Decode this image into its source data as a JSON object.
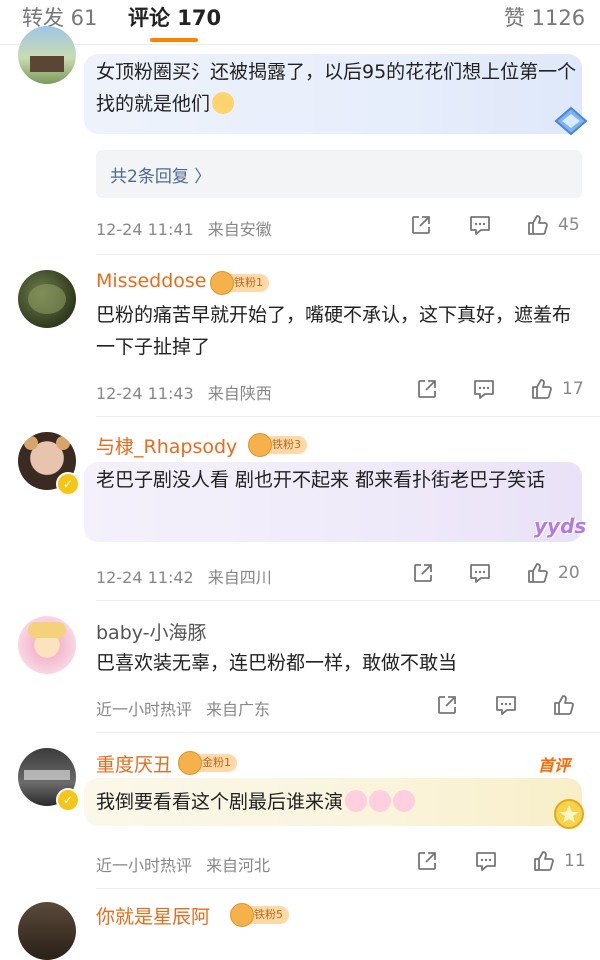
{
  "tabs": {
    "repost": "转发 61",
    "comments": "评论 170",
    "likes": "赞 1126"
  },
  "comments": [
    {
      "text": "女顶粉圈买氵还被揭露了，以后95的花花们想上位第一个找的就是他们",
      "replies": "共2条回复 〉",
      "time": "12-24 11:41",
      "location": "来自安徽",
      "likes": "45"
    },
    {
      "username": "Misseddose",
      "fan_badge": "铁粉1",
      "text": "巴粉的痛苦早就开始了，嘴硬不承认，这下真好，遮羞布一下子扯掉了",
      "time": "12-24 11:43",
      "location": "来自陕西",
      "likes": "17"
    },
    {
      "username": "与棣_Rhapsody",
      "fan_badge": "铁粉3",
      "text": "老巴子剧没人看 剧也开不起来 都来看扑街老巴子笑话",
      "sticker": "yyds",
      "time": "12-24 11:42",
      "location": "来自四川",
      "likes": "20"
    },
    {
      "username": "baby-小海豚",
      "text": "巴喜欢装无辜，连巴粉都一样，敢做不敢当",
      "time": "近一小时热评",
      "location": "来自广东",
      "likes": ""
    },
    {
      "username": "重度厌丑",
      "fan_badge": "金粉1",
      "tag": "首评",
      "text": "我倒要看看这个剧最后谁来演",
      "time": "近一小时热评",
      "location": "来自河北",
      "likes": "11"
    },
    {
      "username": "你就是星辰阿",
      "fan_badge": "铁粉5"
    }
  ]
}
